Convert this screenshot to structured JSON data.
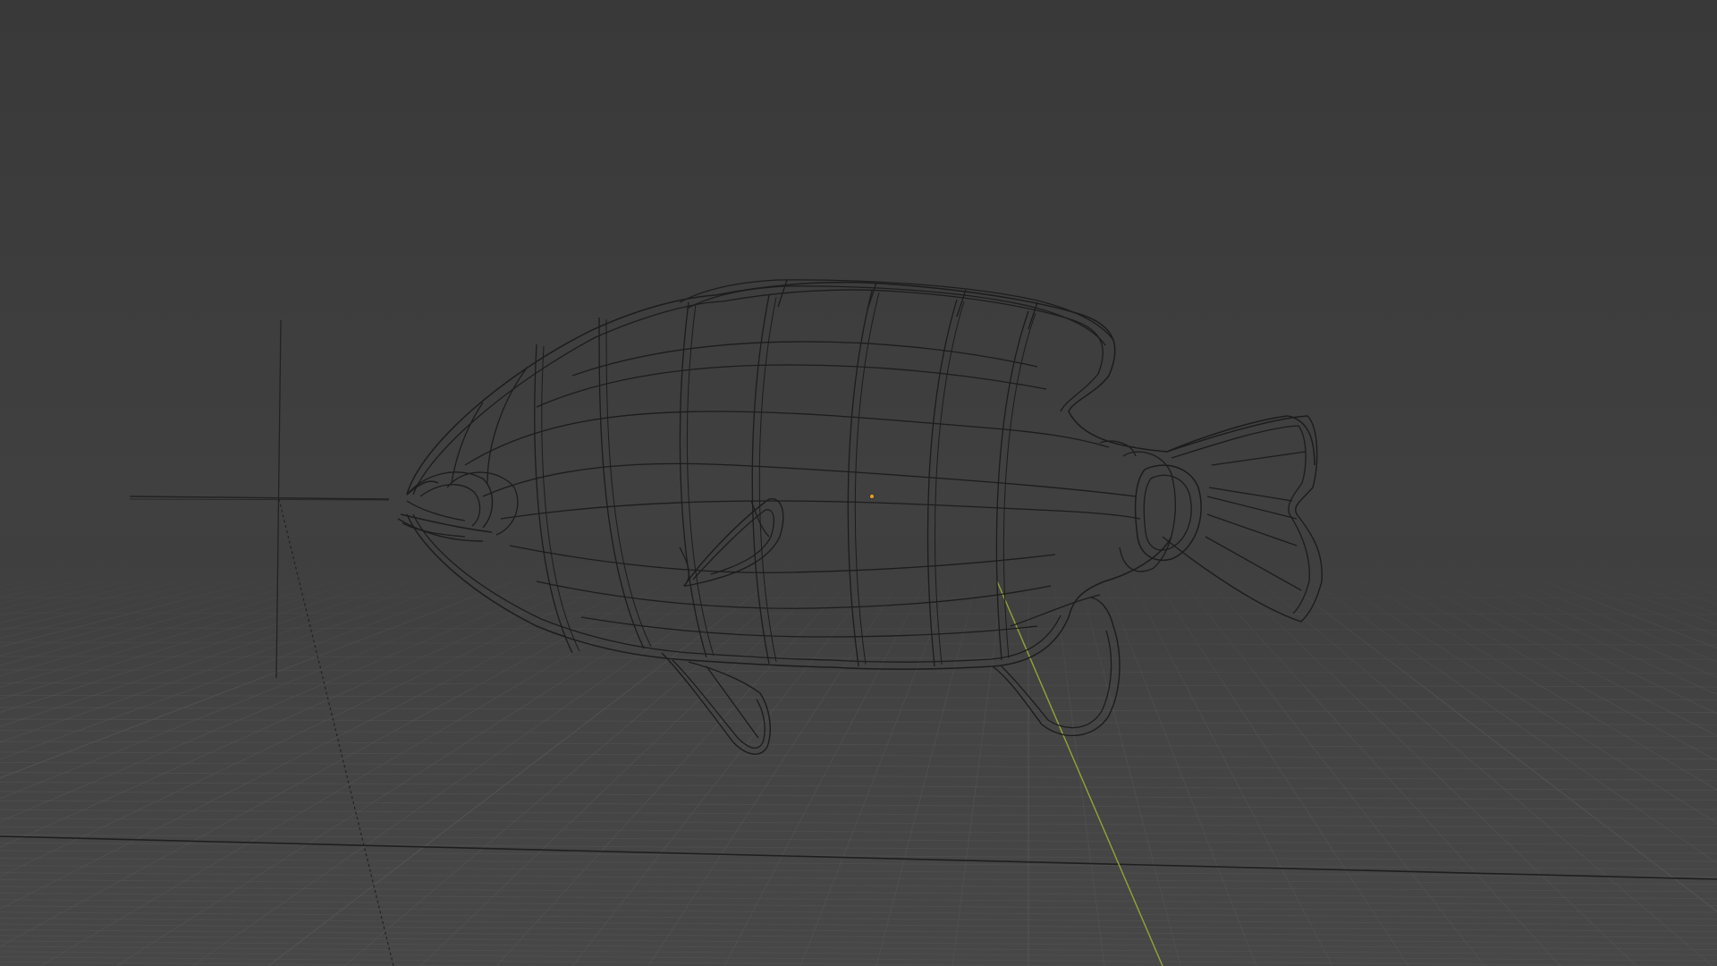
{
  "viewport": {
    "mode": "wireframe",
    "object": "fish-mesh"
  },
  "colors": {
    "background_top": "#393939",
    "background_bottom": "#474747",
    "grid_line": "#555555",
    "grid_major": "#5e5e5e",
    "wire": "#1c1c1c",
    "x_axis": "#1e1e1e",
    "y_axis": "#8fa636",
    "origin_dot": "#e59b2a",
    "empty_axes": "#222222"
  },
  "icons": {
    "origin": "object-origin-icon",
    "empty": "empty-axes-icon"
  }
}
